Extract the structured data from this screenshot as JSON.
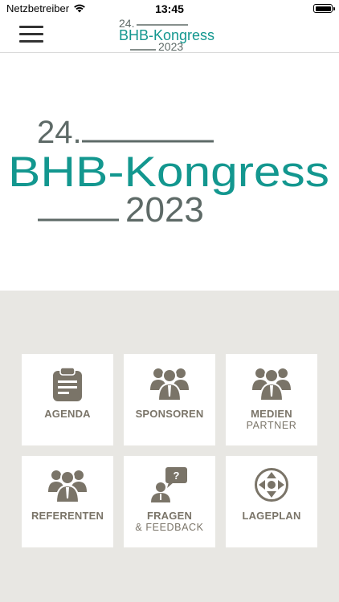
{
  "status_bar": {
    "carrier": "Netzbetreiber",
    "time": "13:45"
  },
  "header": {
    "logo": {
      "line1": "24.",
      "line2": "BHB-Kongress",
      "line3": "2023"
    }
  },
  "hero": {
    "logo": {
      "line1": "24.",
      "line2": "BHB-Kongress",
      "line3": "2023"
    }
  },
  "tiles": [
    {
      "label": "AGENDA",
      "sub": "",
      "icon": "clipboard-icon"
    },
    {
      "label": "SPONSOREN",
      "sub": "",
      "icon": "people-group-icon"
    },
    {
      "label": "MEDIEN",
      "sub": "PARTNER",
      "icon": "people-group-icon"
    },
    {
      "label": "REFERENTEN",
      "sub": "",
      "icon": "people-group-icon"
    },
    {
      "label": "FRAGEN",
      "sub": "& FEEDBACK",
      "icon": "question-bubble-icon"
    },
    {
      "label": "LAGEPLAN",
      "sub": "",
      "icon": "compass-icon"
    }
  ],
  "colors": {
    "brand_teal": "#13978f",
    "brand_gray": "#5e6a67",
    "tile_text": "#7a7468",
    "background": "#e8e7e3"
  }
}
